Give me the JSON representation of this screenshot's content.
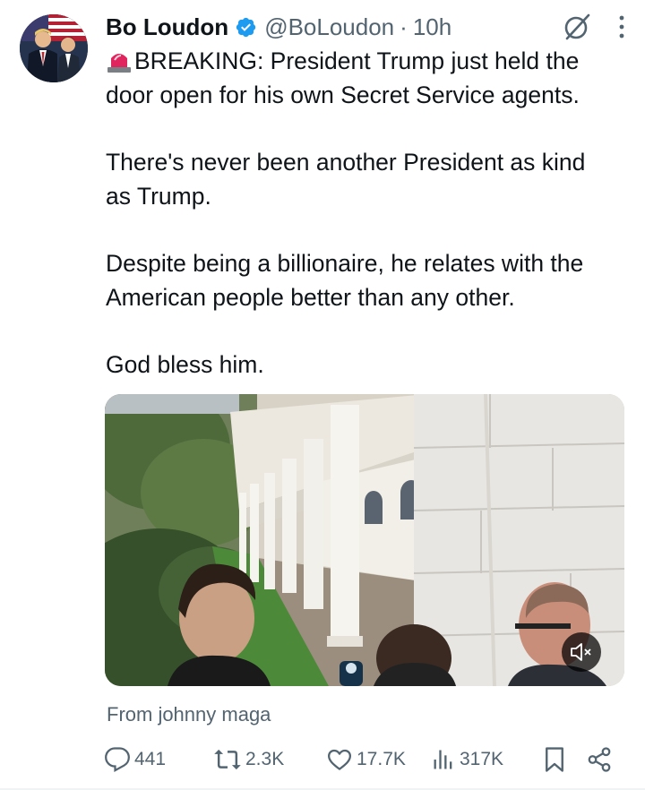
{
  "tweet": {
    "author_name": "Bo Loudon",
    "handle": "@BoLoudon",
    "separator": "·",
    "time": "10h",
    "paragraphs": [
      "BREAKING: President Trump just held the",
      "door open for his own Secret Service agents.",
      "There's never been another President as kind",
      "as Trump.",
      "Despite being a billionaire, he relates with the",
      "American people better than any other.",
      "God bless him."
    ],
    "source": "From johnny maga"
  },
  "actions": {
    "replies": "441",
    "reposts": "2.3K",
    "likes": "17.7K",
    "views": "317K"
  },
  "colors": {
    "text": "#0f1419",
    "muted": "#536471",
    "verified": "#1d9bf0",
    "siren": "#e0245e"
  },
  "icons": [
    "verified-badge-icon",
    "grok-icon",
    "more-icon",
    "siren-icon",
    "mute-icon",
    "reply-icon",
    "repost-icon",
    "like-icon",
    "views-icon",
    "bookmark-icon",
    "share-icon"
  ]
}
